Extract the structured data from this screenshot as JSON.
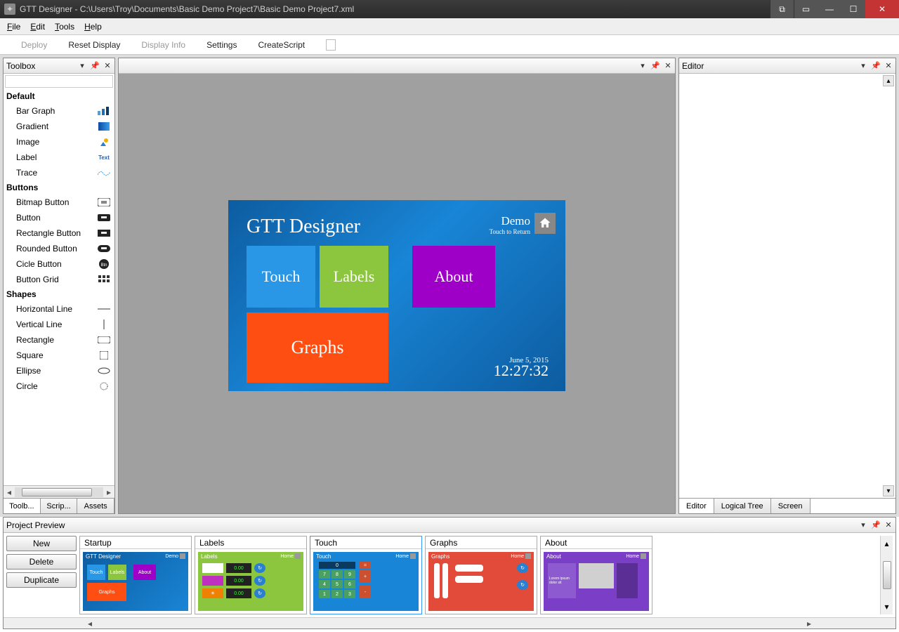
{
  "window": {
    "title": "GTT Designer - C:\\Users\\Troy\\Documents\\Basic Demo Project7\\Basic Demo Project7.xml"
  },
  "menu": {
    "file": "File",
    "edit": "Edit",
    "tools": "Tools",
    "help": "Help"
  },
  "actions": {
    "deploy": "Deploy",
    "reset": "Reset Display",
    "info": "Display Info",
    "settings": "Settings",
    "script": "CreateScript"
  },
  "toolbox": {
    "title": "Toolbox",
    "groups": [
      {
        "name": "Default",
        "items": [
          {
            "label": "Bar Graph",
            "icon": "bar-graph-icon"
          },
          {
            "label": "Gradient",
            "icon": "gradient-icon"
          },
          {
            "label": "Image",
            "icon": "image-icon"
          },
          {
            "label": "Label",
            "icon": "label-icon"
          },
          {
            "label": "Trace",
            "icon": "trace-icon"
          }
        ]
      },
      {
        "name": "Buttons",
        "items": [
          {
            "label": "Bitmap Button",
            "icon": "bitmap-button-icon"
          },
          {
            "label": "Button",
            "icon": "button-icon"
          },
          {
            "label": "Rectangle Button",
            "icon": "rectangle-button-icon"
          },
          {
            "label": "Rounded Button",
            "icon": "rounded-button-icon"
          },
          {
            "label": "Cicle Button",
            "icon": "circle-button-icon"
          },
          {
            "label": "Button Grid",
            "icon": "button-grid-icon"
          }
        ]
      },
      {
        "name": "Shapes",
        "items": [
          {
            "label": "Horizontal Line",
            "icon": "hline-icon"
          },
          {
            "label": "Vertical Line",
            "icon": "vline-icon"
          },
          {
            "label": "Rectangle",
            "icon": "rect-icon"
          },
          {
            "label": "Square",
            "icon": "square-icon"
          },
          {
            "label": "Ellipse",
            "icon": "ellipse-icon"
          },
          {
            "label": "Circle",
            "icon": "circle-icon"
          }
        ]
      }
    ],
    "tabs": {
      "toolbox": "Toolb...",
      "scripts": "Scrip...",
      "assets": "Assets"
    }
  },
  "canvas_screen": {
    "title": "GTT Designer",
    "demo_label": "Demo",
    "demo_sub": "Touch to Return",
    "tiles": {
      "touch": "Touch",
      "labels": "Labels",
      "about": "About",
      "graphs": "Graphs"
    },
    "date": "June 5, 2015",
    "time": "12:27:32"
  },
  "editor": {
    "title": "Editor",
    "tabs": {
      "editor": "Editor",
      "tree": "Logical Tree",
      "screen": "Screen"
    }
  },
  "preview": {
    "title": "Project Preview",
    "buttons": {
      "new": "New",
      "delete": "Delete",
      "duplicate": "Duplicate"
    },
    "screens": [
      {
        "name": "Startup"
      },
      {
        "name": "Labels"
      },
      {
        "name": "Touch"
      },
      {
        "name": "Graphs"
      },
      {
        "name": "About"
      }
    ]
  },
  "mini": {
    "startup": {
      "title": "GTT Designer",
      "home": "Demo",
      "t1": "Touch",
      "t2": "Labels",
      "t3": "About",
      "t4": "Graphs"
    },
    "labels": {
      "title": "Labels",
      "home": "Home",
      "v1": "0.00",
      "v2": "0.00",
      "v3": "0.00"
    },
    "touch": {
      "title": "Touch",
      "home": "Home",
      "k7": "7",
      "k8": "8",
      "k9": "9",
      "k4": "4",
      "k5": "5",
      "k6": "6",
      "k1": "1",
      "k2": "2",
      "k3": "3",
      "eq": "=",
      "plus": "+",
      "minus": "-",
      "zero": "0"
    },
    "graphs": {
      "title": "Graphs",
      "home": "Home"
    },
    "about": {
      "title": "About",
      "home": "Home"
    }
  }
}
